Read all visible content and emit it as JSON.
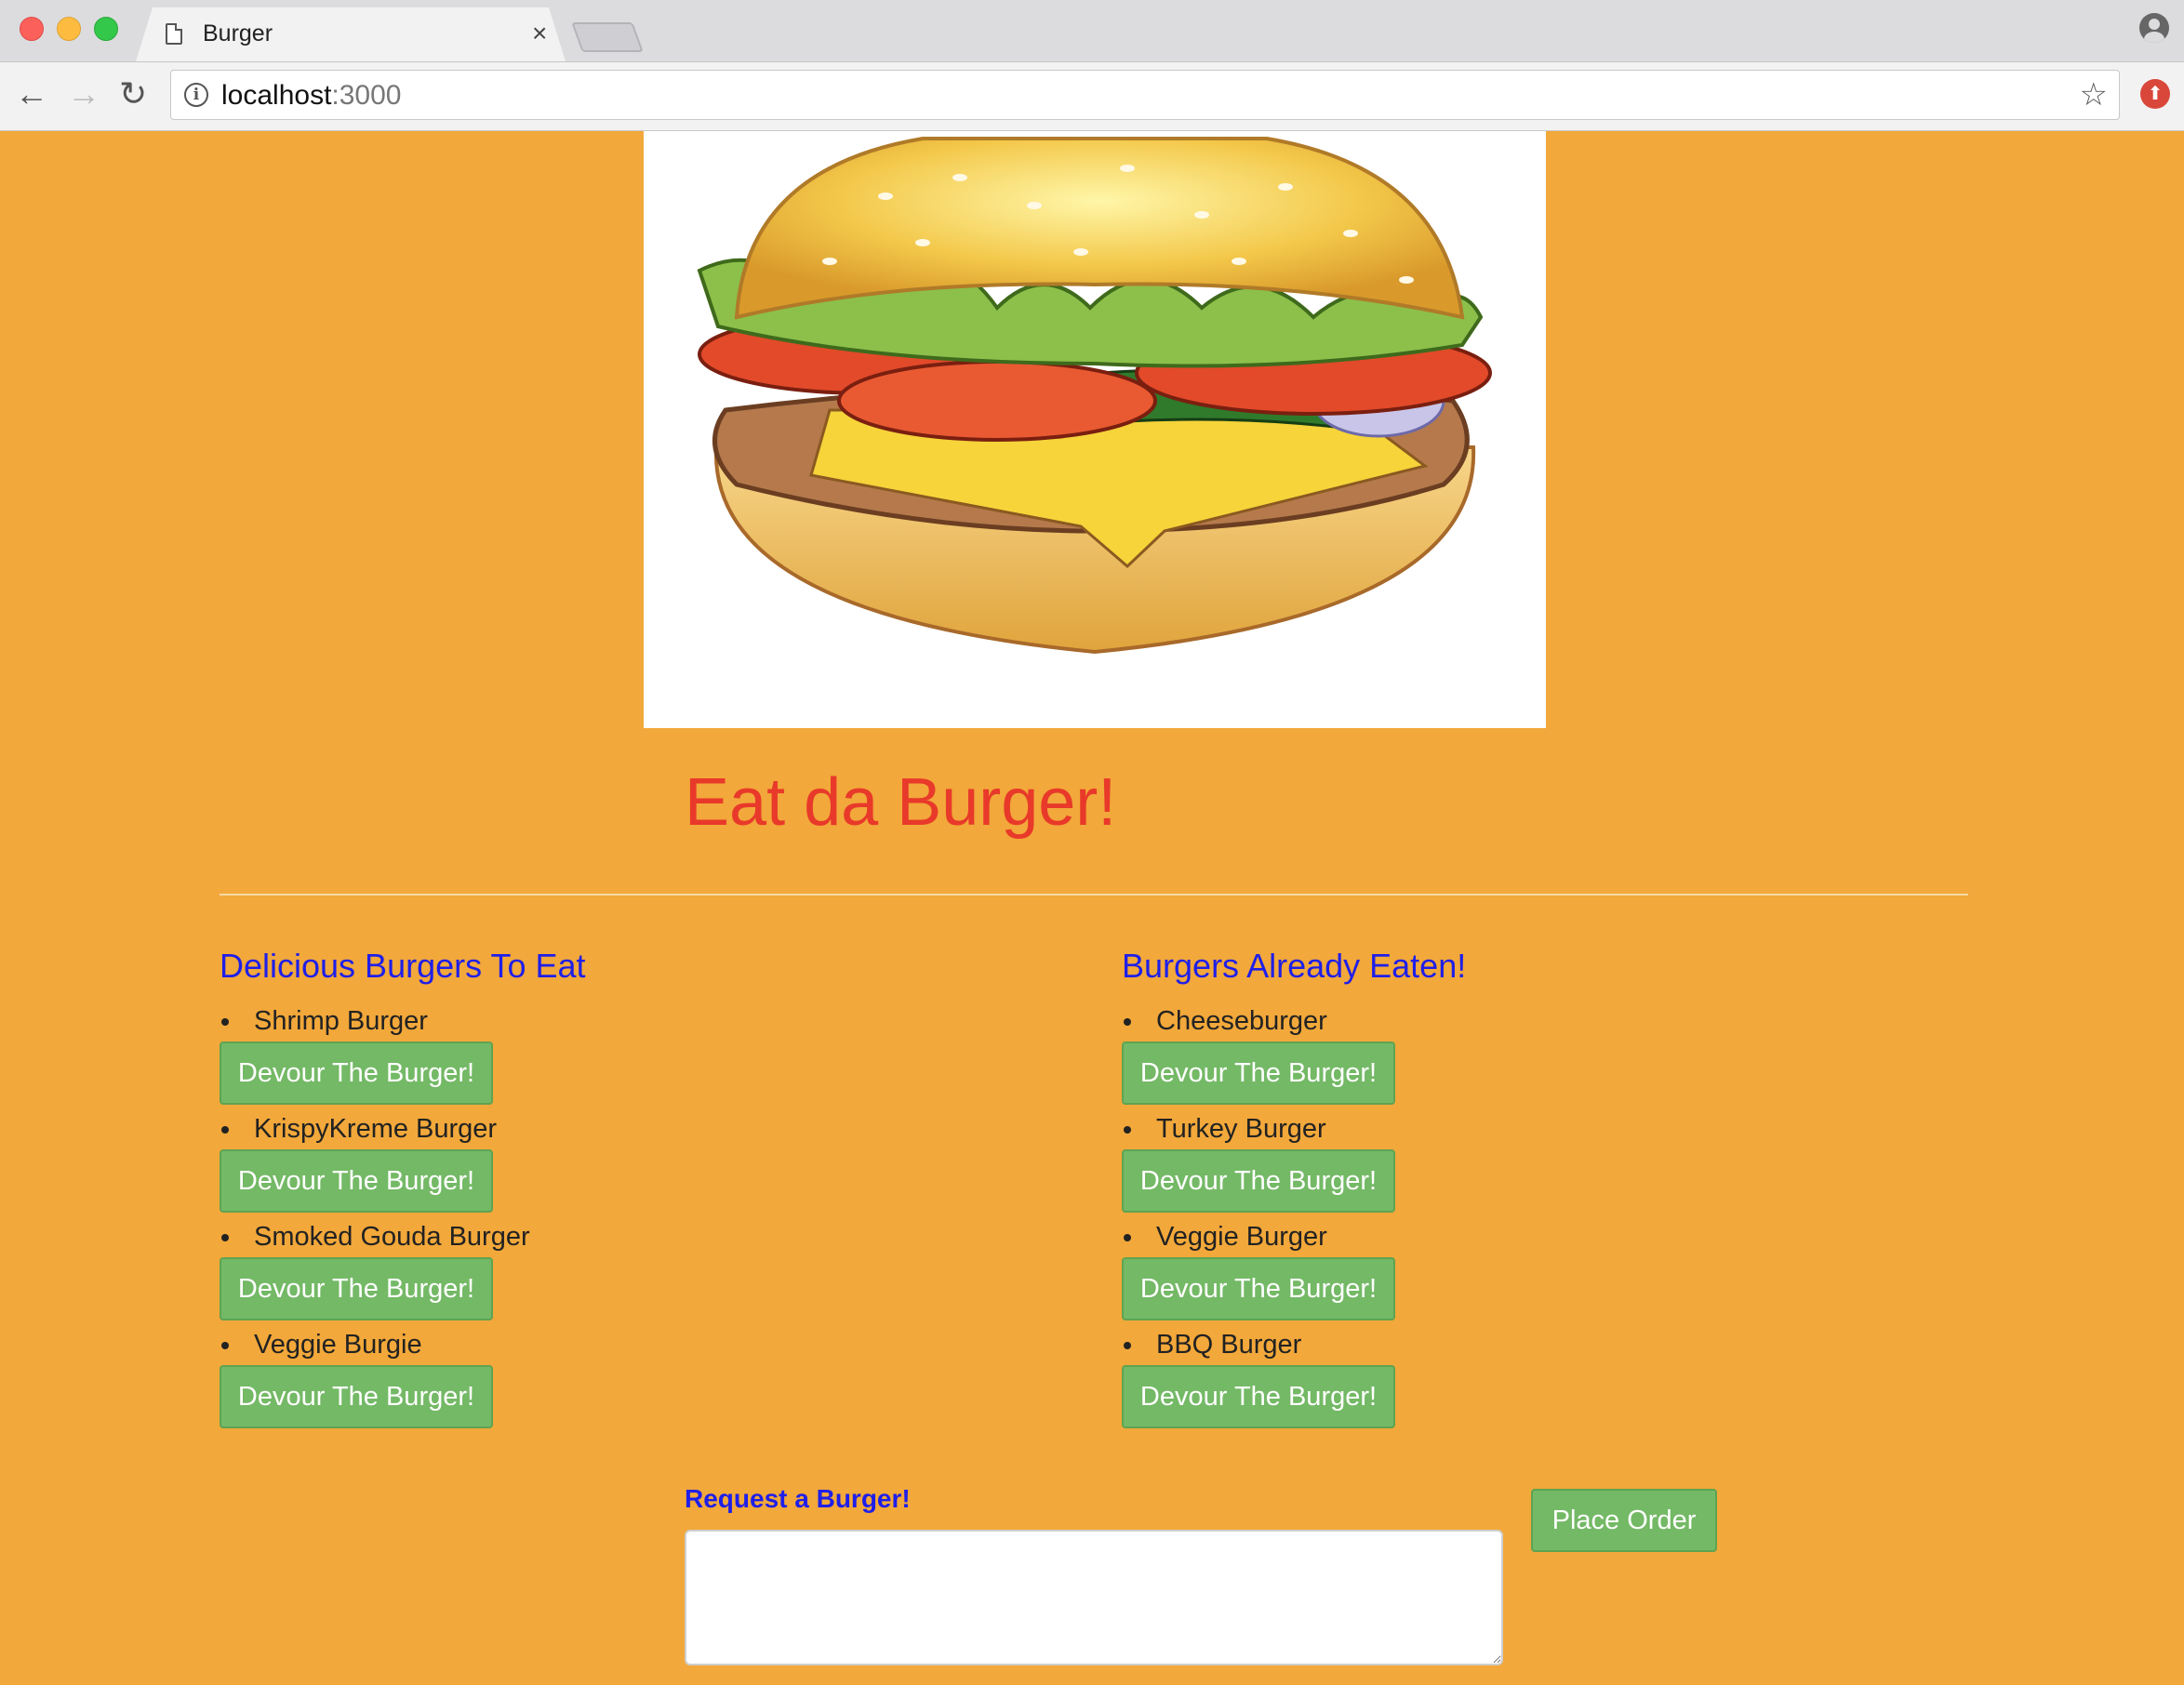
{
  "browser": {
    "tab_title": "Burger",
    "url_host": "localhost",
    "url_port": ":3000"
  },
  "page": {
    "title": "Eat da Burger!",
    "to_eat": {
      "heading": "Delicious Burgers To Eat",
      "items": [
        {
          "name": "Shrimp Burger",
          "button": "Devour The Burger!"
        },
        {
          "name": "KrispyKreme Burger",
          "button": "Devour The Burger!"
        },
        {
          "name": "Smoked Gouda Burger",
          "button": "Devour The Burger!"
        },
        {
          "name": "Veggie Burgie",
          "button": "Devour The Burger!"
        }
      ]
    },
    "eaten": {
      "heading": "Burgers Already Eaten!",
      "items": [
        {
          "name": "Cheeseburger",
          "button": "Devour The Burger!"
        },
        {
          "name": "Turkey Burger",
          "button": "Devour The Burger!"
        },
        {
          "name": "Veggie Burger",
          "button": "Devour The Burger!"
        },
        {
          "name": "BBQ Burger",
          "button": "Devour The Burger!"
        }
      ]
    },
    "request": {
      "label": "Request a Burger!",
      "value": "",
      "submit": "Place Order"
    }
  },
  "colors": {
    "page_bg": "#f2a83a",
    "title": "#e8392a",
    "headings": "#1f1fe8",
    "button": "#74b966"
  }
}
